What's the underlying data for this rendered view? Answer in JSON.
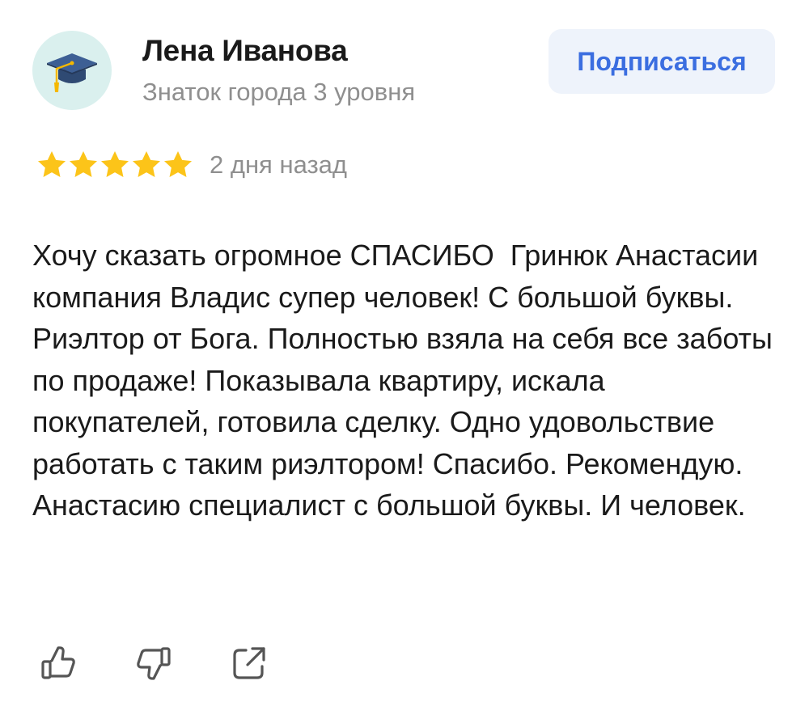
{
  "author": {
    "name": "Лена Иванова",
    "level": "Знаток города 3 уровня",
    "avatar_icon": "graduation-cap-icon"
  },
  "subscribe": {
    "label": "Подписаться"
  },
  "rating": {
    "stars": 5,
    "max_stars": 5,
    "date": "2 дня назад"
  },
  "review": {
    "text": "Хочу сказать огромное СПАСИБО  Гринюк Анастасии компания Владис супер человек! С большой буквы. Риэлтор от Бога. Полностью взяла на себя все заботы по продаже! Показывала квартиру, искала покупателей, готовила сделку. Одно удовольствие работать с таким риэлтором! Спасибо. Рекомендую. Анастасию специалист с большой буквы. И человек."
  },
  "actions": [
    {
      "icon": "thumbs-up-icon"
    },
    {
      "icon": "thumbs-down-icon"
    },
    {
      "icon": "share-icon"
    }
  ],
  "colors": {
    "accent": "#3b6ee0",
    "button_bg": "#eef3fb",
    "star": "#fcc419",
    "avatar_bg": "#daf0ee",
    "muted_text": "#8f8f8f"
  }
}
